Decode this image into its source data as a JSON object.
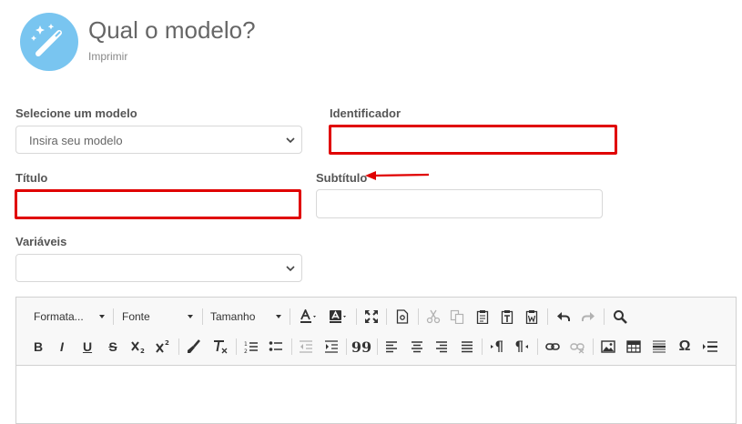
{
  "header": {
    "title": "Qual o modelo?",
    "subtitle": "Imprimir",
    "icon": "magic-wand-icon",
    "icon_bg": "#79c5f0"
  },
  "form": {
    "model": {
      "label": "Selecione um modelo",
      "placeholder": "Insira seu modelo"
    },
    "identifier": {
      "label": "Identificador",
      "value": ""
    },
    "title": {
      "label": "Título",
      "value": ""
    },
    "subtitle": {
      "label": "Subtítulo",
      "value": ""
    },
    "variables": {
      "label": "Variáveis",
      "value": ""
    },
    "highlight_color": "#e00000"
  },
  "editor": {
    "format_combo": "Formata...",
    "font_combo": "Fonte",
    "size_combo": "Tamanho",
    "row1_icons": [
      "text-color-icon",
      "background-color-icon",
      "maximize-icon",
      "preview-icon",
      "cut-icon",
      "copy-icon",
      "paste-icon",
      "paste-text-icon",
      "paste-word-icon",
      "undo-icon",
      "redo-icon",
      "find-icon"
    ],
    "row2_icons": [
      "bold-icon",
      "italic-icon",
      "underline-icon",
      "strikethrough-icon",
      "subscript-icon",
      "superscript-icon",
      "copy-format-icon",
      "remove-format-icon",
      "numbered-list-icon",
      "bulleted-list-icon",
      "outdent-icon",
      "indent-icon",
      "blockquote-icon",
      "align-left-icon",
      "align-center-icon",
      "align-right-icon",
      "justify-icon",
      "ltr-icon",
      "rtl-icon",
      "link-icon",
      "unlink-icon",
      "image-icon",
      "table-icon",
      "horizontal-line-icon",
      "special-char-icon",
      "page-break-icon"
    ],
    "glyphs": {
      "bold": "B",
      "italic": "I",
      "underline": "U",
      "strike": "S",
      "quote": "99",
      "omega": "Ω"
    }
  }
}
